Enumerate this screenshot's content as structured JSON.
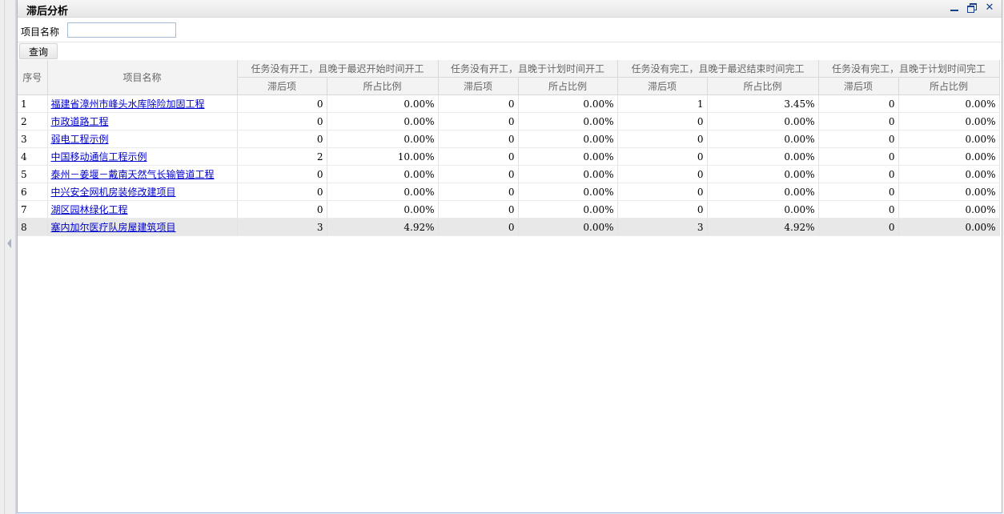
{
  "window": {
    "title": "滞后分析"
  },
  "search": {
    "label": "项目名称",
    "value": "",
    "button": "查询"
  },
  "table": {
    "col_index": "序号",
    "col_name": "项目名称",
    "groups": [
      "任务没有开工，且晚于最迟开始时间开工",
      "任务没有开工，且晚于计划时间开工",
      "任务没有完工，且晚于最迟结束时间完工",
      "任务没有完工，且晚于计划时间完工"
    ],
    "sub_count": "滞后项",
    "sub_ratio": "所占比例",
    "rows": [
      {
        "idx": "1",
        "name": "福建省漳州市峰头水库除险加固工程",
        "c": [
          "0",
          "0.00%",
          "0",
          "0.00%",
          "1",
          "3.45%",
          "0",
          "0.00%"
        ]
      },
      {
        "idx": "2",
        "name": "市政道路工程",
        "c": [
          "0",
          "0.00%",
          "0",
          "0.00%",
          "0",
          "0.00%",
          "0",
          "0.00%"
        ]
      },
      {
        "idx": "3",
        "name": "弱电工程示例",
        "c": [
          "0",
          "0.00%",
          "0",
          "0.00%",
          "0",
          "0.00%",
          "0",
          "0.00%"
        ]
      },
      {
        "idx": "4",
        "name": "中国移动通信工程示例",
        "c": [
          "2",
          "10.00%",
          "0",
          "0.00%",
          "0",
          "0.00%",
          "0",
          "0.00%"
        ]
      },
      {
        "idx": "5",
        "name": "泰州－姜堰－戴南天然气长输管道工程",
        "c": [
          "0",
          "0.00%",
          "0",
          "0.00%",
          "0",
          "0.00%",
          "0",
          "0.00%"
        ]
      },
      {
        "idx": "6",
        "name": "中兴安全网机房装修改建项目",
        "c": [
          "0",
          "0.00%",
          "0",
          "0.00%",
          "0",
          "0.00%",
          "0",
          "0.00%"
        ]
      },
      {
        "idx": "7",
        "name": "湖区园林绿化工程",
        "c": [
          "0",
          "0.00%",
          "0",
          "0.00%",
          "0",
          "0.00%",
          "0",
          "0.00%"
        ]
      },
      {
        "idx": "8",
        "name": "塞内加尔医疗队房屋建筑项目",
        "c": [
          "3",
          "4.92%",
          "0",
          "0.00%",
          "3",
          "4.92%",
          "0",
          "0.00%"
        ]
      }
    ]
  }
}
